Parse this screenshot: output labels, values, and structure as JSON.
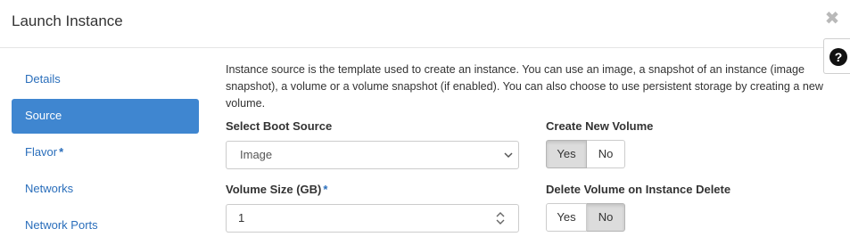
{
  "modal": {
    "title": "Launch Instance",
    "close_glyph": "✖",
    "help_glyph": "?"
  },
  "nav": {
    "items": [
      {
        "label": "Details",
        "active": false,
        "required": false
      },
      {
        "label": "Source",
        "active": true,
        "required": false
      },
      {
        "label": "Flavor",
        "active": false,
        "required": true
      },
      {
        "label": "Networks",
        "active": false,
        "required": false
      },
      {
        "label": "Network Ports",
        "active": false,
        "required": false
      }
    ],
    "required_mark": "*"
  },
  "source": {
    "description": "Instance source is the template used to create an instance. You can use an image, a snapshot of an instance (image snapshot), a volume or a volume snapshot (if enabled). You can also choose to use persistent storage by creating a new volume.",
    "boot_source": {
      "label": "Select Boot Source",
      "value": "Image"
    },
    "volume_size": {
      "label": "Volume Size (GB)",
      "required_mark": "*",
      "value": "1"
    },
    "create_new_volume": {
      "label": "Create New Volume",
      "yes": "Yes",
      "no": "No",
      "selected": "Yes"
    },
    "delete_on_instance_delete": {
      "label": "Delete Volume on Instance Delete",
      "yes": "Yes",
      "no": "No",
      "selected": "No"
    }
  },
  "icons": {
    "close": "close-icon",
    "help": "question-circle-icon",
    "select_caret": "chevron-down-icon",
    "spinner": "spinner-arrows-icon"
  },
  "colors": {
    "accent": "#3f86d0",
    "link": "#2a6ebb",
    "toggle_active": "#dcdcdc"
  }
}
